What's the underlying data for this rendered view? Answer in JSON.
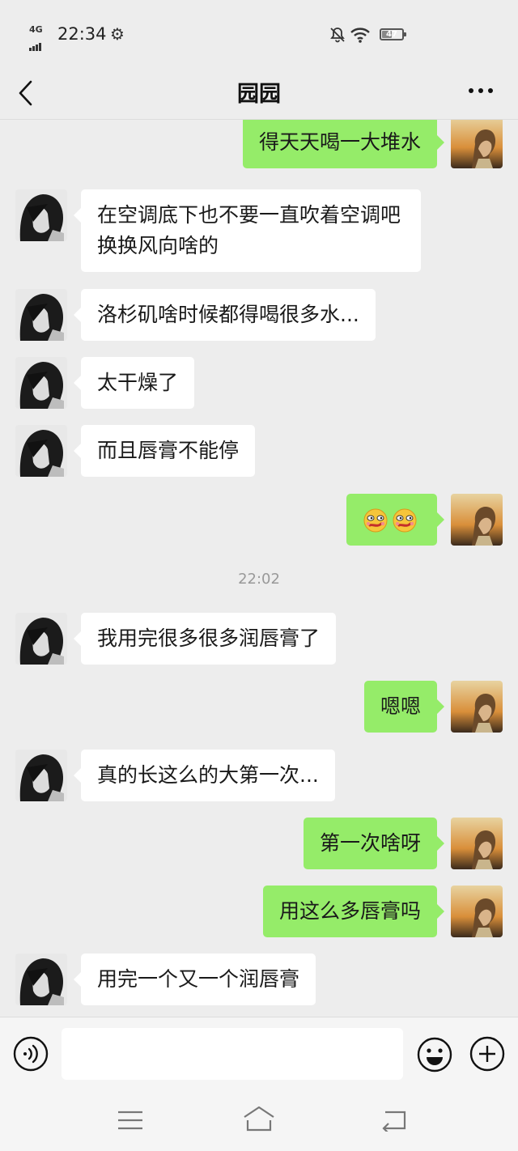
{
  "status": {
    "network": "4G",
    "time": "22:34",
    "battery": "47"
  },
  "header": {
    "title": "园园"
  },
  "messages": [
    {
      "side": "out",
      "text": "得天天喝一大堆水"
    },
    {
      "side": "in",
      "text": "在空调底下也不要一直吹着空调吧　换换风向啥的"
    },
    {
      "side": "in",
      "text": "洛杉矶啥时候都得喝很多水..."
    },
    {
      "side": "in",
      "text": "太干燥了"
    },
    {
      "side": "in",
      "text": "而且唇膏不能停"
    },
    {
      "side": "out",
      "type": "emoji",
      "emoji": [
        "smirk-emoji",
        "smirk-emoji"
      ]
    },
    {
      "side": "in",
      "text": "我用完很多很多润唇膏了"
    },
    {
      "side": "out",
      "text": "嗯嗯"
    },
    {
      "side": "in",
      "text": "真的长这么的大第一次..."
    },
    {
      "side": "out",
      "text": "第一次啥呀"
    },
    {
      "side": "out",
      "text": "用这么多唇膏吗"
    },
    {
      "side": "in",
      "text": "用完一个又一个润唇膏"
    }
  ],
  "timestamp": "22:02",
  "input": {
    "placeholder": ""
  },
  "colors": {
    "outgoing_bubble": "#95ec69",
    "incoming_bubble": "#ffffff",
    "background": "#ededed"
  }
}
